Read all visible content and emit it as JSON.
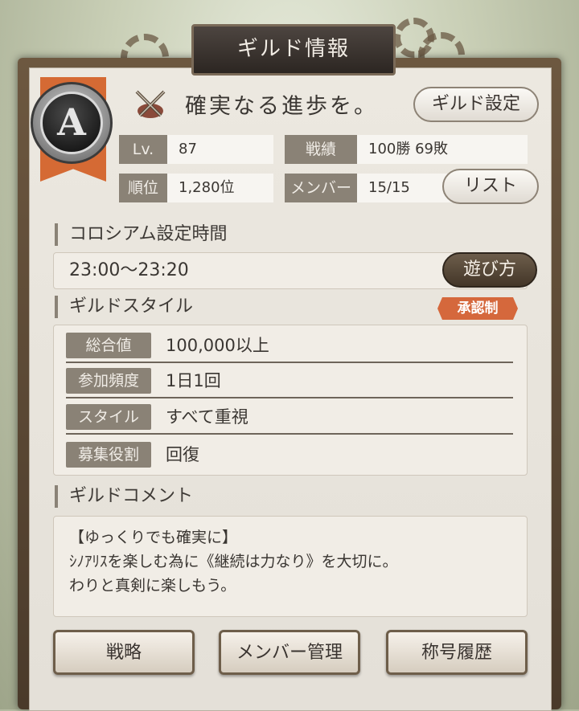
{
  "header": {
    "title": "ギルド情報"
  },
  "guild": {
    "rank": "A",
    "name": "確実なる進歩を。",
    "settings_button": "ギルド設定"
  },
  "stats": {
    "level_label": "Lv.",
    "level_value": "87",
    "record_label": "戦績",
    "record_value": "100勝  69敗",
    "ranking_label": "順位",
    "ranking_value": "1,280位",
    "members_label": "メンバー",
    "members_value": "15/15",
    "list_button": "リスト"
  },
  "colosseum": {
    "section_title": "コロシアム設定時間",
    "time": "23:00〜23:20",
    "howto_button": "遊び方"
  },
  "style": {
    "section_title": "ギルドスタイル",
    "approval_badge": "承認制",
    "rows": [
      {
        "label": "総合値",
        "value": "100,000以上"
      },
      {
        "label": "参加頻度",
        "value": "1日1回"
      },
      {
        "label": "スタイル",
        "value": "すべて重視"
      },
      {
        "label": "募集役割",
        "value": "回復"
      }
    ]
  },
  "comment": {
    "section_title": "ギルドコメント",
    "lines": [
      "【ゆっくりでも確実に】",
      "ｼﾉｱﾘｽを楽しむ為に《継続は力なり》を大切に。",
      "わりと真剣に楽しもう。"
    ]
  },
  "footer": {
    "strategy_button": "戦略",
    "member_mgmt_button": "メンバー管理",
    "title_history_button": "称号履歴"
  },
  "colors": {
    "accent_orange": "#d56a34",
    "label_gray": "#8a8276",
    "panel_paper": "#ece8e0",
    "frame_brown": "#4a3a2a"
  }
}
